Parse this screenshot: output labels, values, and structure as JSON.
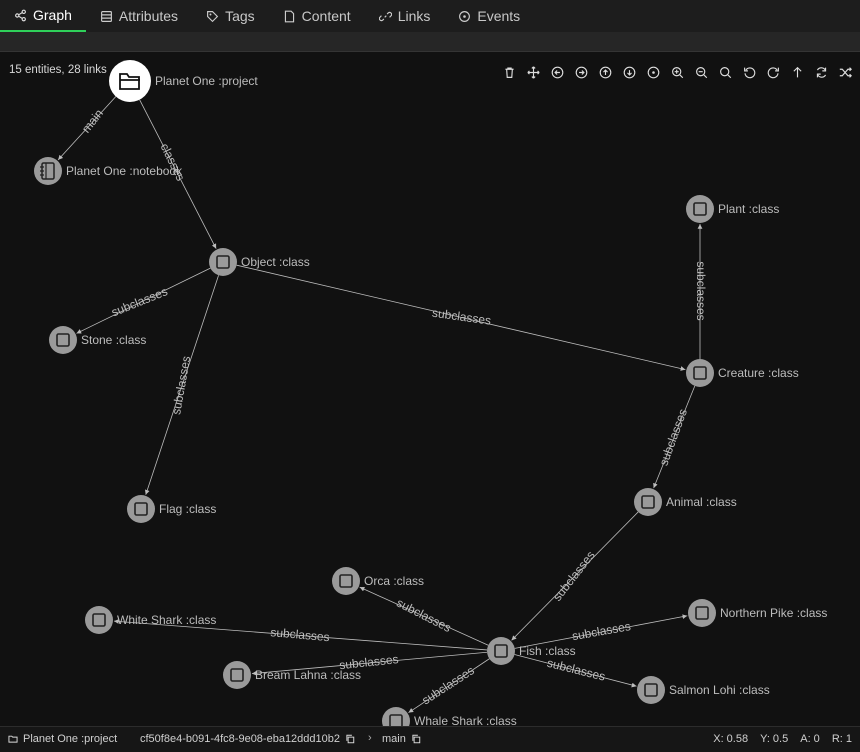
{
  "tabs": [
    {
      "label": "Graph",
      "icon": "share-nodes-icon",
      "active": true
    },
    {
      "label": "Attributes",
      "icon": "table-icon"
    },
    {
      "label": "Tags",
      "icon": "tag-icon"
    },
    {
      "label": "Content",
      "icon": "file-icon"
    },
    {
      "label": "Links",
      "icon": "link-icon"
    },
    {
      "label": "Events",
      "icon": "circle-dot-icon"
    }
  ],
  "graph": {
    "summary": "15 entities, 28 links",
    "nodes": [
      {
        "id": "project",
        "label": "Planet One :project",
        "icon": "folder-icon",
        "root": true
      },
      {
        "id": "notebook",
        "label": "Planet One :notebook",
        "icon": "notebook-icon"
      },
      {
        "id": "object",
        "label": "Object :class",
        "icon": "square-icon"
      },
      {
        "id": "plant",
        "label": "Plant :class",
        "icon": "square-icon"
      },
      {
        "id": "stone",
        "label": "Stone :class",
        "icon": "square-icon"
      },
      {
        "id": "creature",
        "label": "Creature :class",
        "icon": "square-icon"
      },
      {
        "id": "flag",
        "label": "Flag :class",
        "icon": "square-icon"
      },
      {
        "id": "animal",
        "label": "Animal :class",
        "icon": "square-icon"
      },
      {
        "id": "orca",
        "label": "Orca :class",
        "icon": "square-icon"
      },
      {
        "id": "whiteshark",
        "label": "White Shark :class",
        "icon": "square-icon"
      },
      {
        "id": "northernpike",
        "label": "Northern Pike :class",
        "icon": "square-icon"
      },
      {
        "id": "fish",
        "label": "Fish :class",
        "icon": "square-icon"
      },
      {
        "id": "breamlahna",
        "label": "Bream Lahna :class",
        "icon": "square-icon"
      },
      {
        "id": "salmonlohi",
        "label": "Salmon Lohi :class",
        "icon": "square-icon"
      },
      {
        "id": "whaleshark",
        "label": "Whale Shark :class",
        "icon": "square-icon"
      }
    ],
    "links": [
      {
        "from": "project",
        "to": "notebook",
        "label": "main"
      },
      {
        "from": "project",
        "to": "object",
        "label": "classes"
      },
      {
        "from": "object",
        "to": "stone",
        "label": "subclasses"
      },
      {
        "from": "object",
        "to": "flag",
        "label": "subclasses"
      },
      {
        "from": "object",
        "to": "creature",
        "label": "subclasses"
      },
      {
        "from": "creature",
        "to": "plant",
        "label": "subclasses"
      },
      {
        "from": "creature",
        "to": "animal",
        "label": "subclasses"
      },
      {
        "from": "animal",
        "to": "fish",
        "label": "subclasses"
      },
      {
        "from": "fish",
        "to": "orca",
        "label": "subclasses"
      },
      {
        "from": "fish",
        "to": "whiteshark",
        "label": "subclasses"
      },
      {
        "from": "fish",
        "to": "breamlahna",
        "label": "subclasses"
      },
      {
        "from": "fish",
        "to": "whaleshark",
        "label": "subclasses"
      },
      {
        "from": "fish",
        "to": "northernpike",
        "label": "subclasses"
      },
      {
        "from": "fish",
        "to": "salmonlohi",
        "label": "subclasses"
      }
    ]
  },
  "toolbar": [
    "trash-icon",
    "move-icon",
    "arrow-left-circle-icon",
    "arrow-right-circle-icon",
    "arrow-up-circle-icon",
    "arrow-down-circle-icon",
    "target-icon",
    "zoom-in-icon",
    "zoom-out-icon",
    "search-icon",
    "rotate-left-icon",
    "rotate-right-icon",
    "arrow-up-icon",
    "refresh-icon",
    "shuffle-icon"
  ],
  "status": {
    "project": "Planet One :project",
    "id": "cf50f8e4-b091-4fc8-9e08-eba12ddd10b2",
    "branch": "main",
    "x": "X: 0.58",
    "y": "Y: 0.5",
    "a": "A: 0",
    "r": "R: 1"
  },
  "colors": {
    "accent": "#2fd05a",
    "node": "#9a9a9a",
    "edge": "#bdbdbd",
    "label": "#bdbdbd"
  }
}
